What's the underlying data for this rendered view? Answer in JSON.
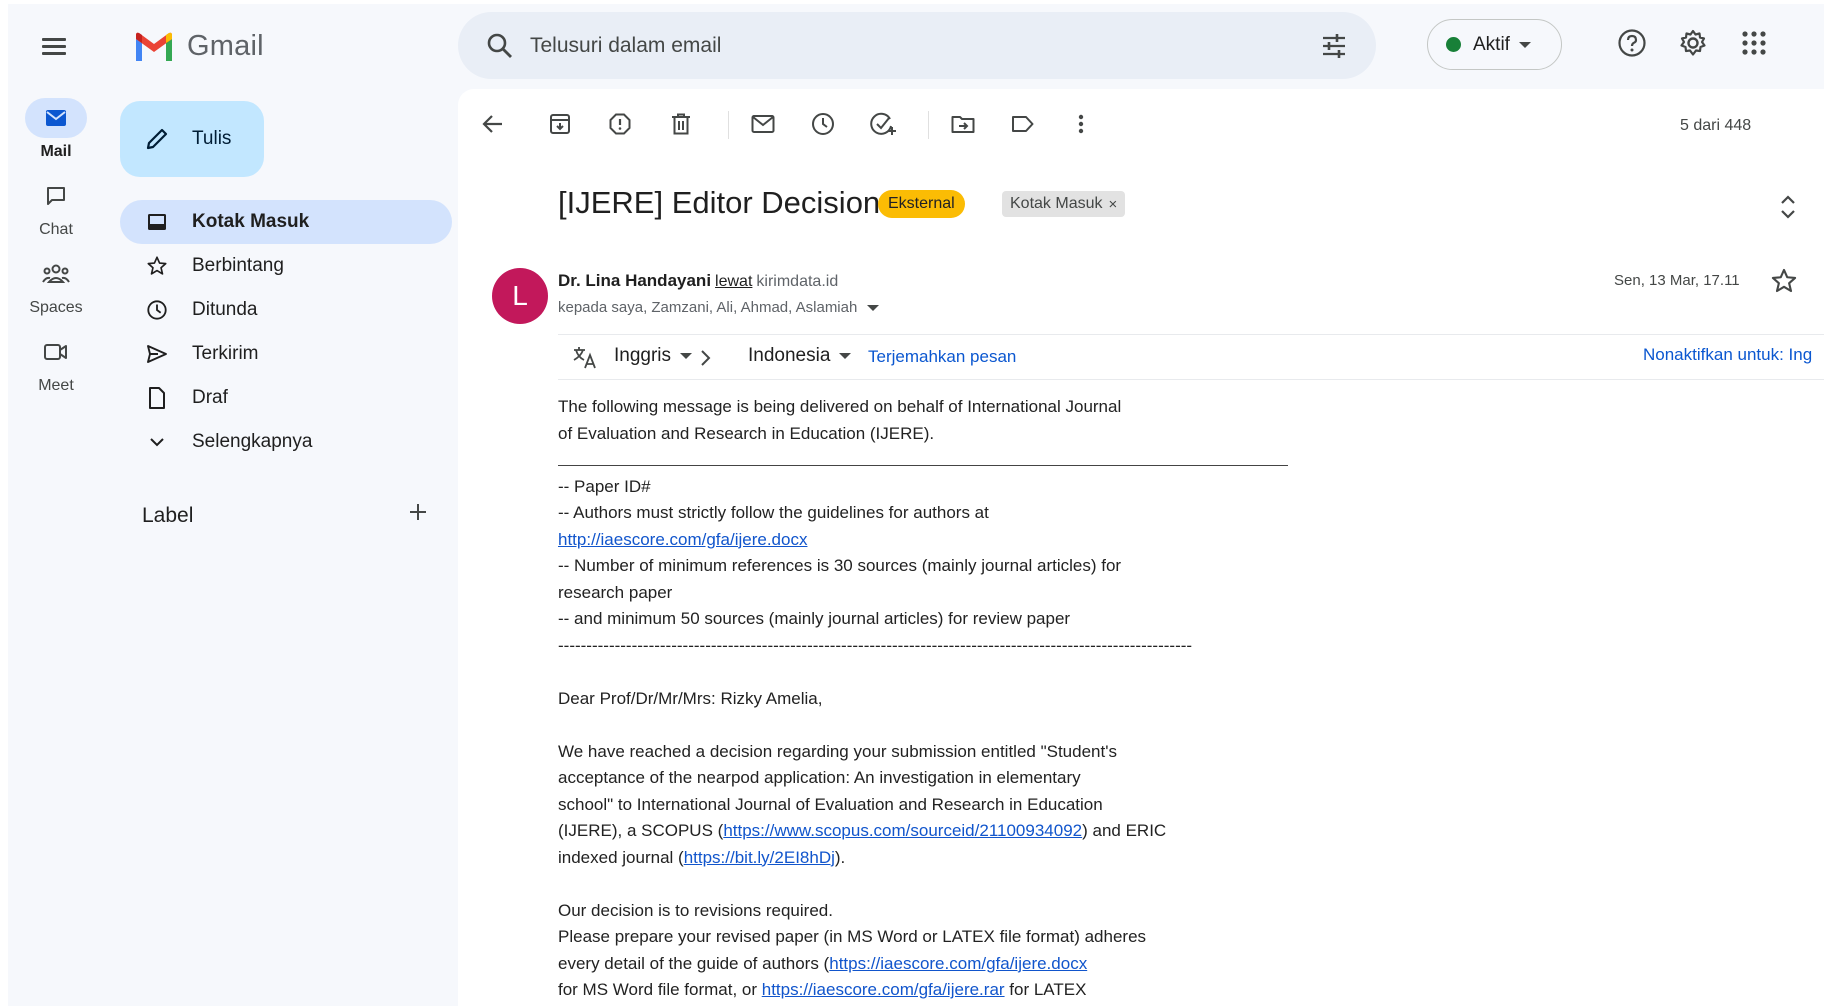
{
  "app": {
    "name": "Gmail"
  },
  "rail": [
    {
      "label": "Mail",
      "icon": "mail-icon",
      "active": true
    },
    {
      "label": "Chat",
      "icon": "chat-icon",
      "active": false
    },
    {
      "label": "Spaces",
      "icon": "spaces-icon",
      "active": false
    },
    {
      "label": "Meet",
      "icon": "meet-icon",
      "active": false
    }
  ],
  "compose": {
    "label": "Tulis"
  },
  "nav": [
    {
      "label": "Kotak Masuk",
      "icon": "inbox-icon",
      "active": true
    },
    {
      "label": "Berbintang",
      "icon": "star-icon"
    },
    {
      "label": "Ditunda",
      "icon": "clock-icon"
    },
    {
      "label": "Terkirim",
      "icon": "send-icon"
    },
    {
      "label": "Draf",
      "icon": "draft-icon"
    },
    {
      "label": "Selengkapnya",
      "icon": "chevron-down-icon"
    }
  ],
  "labels": {
    "heading": "Label"
  },
  "search": {
    "placeholder": "Telusuri dalam email"
  },
  "status": {
    "label": "Aktif",
    "color": "#188038"
  },
  "toolbar": {
    "count": "5 dari 448"
  },
  "email": {
    "subject": "[IJERE] Editor Decision",
    "badge_external": "Eksternal",
    "badge_inbox": "Kotak Masuk",
    "avatar_letter": "L",
    "sender_name": "Dr. Lina Handayani",
    "via": "lewat",
    "via_domain": "kirimdata.id",
    "recipients": "kepada saya, Zamzani, Ali, Ahmad, Aslamiah",
    "date": "Sen, 13 Mar, 17.11"
  },
  "translate": {
    "from": "Inggris",
    "to": "Indonesia",
    "translate_link": "Terjemahkan pesan",
    "disable_link": "Nonaktifkan untuk: Ing"
  },
  "body": {
    "intro_1": "The following message is being delivered on behalf of International Journal",
    "intro_2": "of Evaluation and Research in Education (IJERE).",
    "l_paper_id": "-- Paper ID#",
    "l_guidelines": "-- Authors must strictly follow the guidelines for authors at",
    "link_guide": "http://iaescore.com/gfa/ijere.docx",
    "l_refs_1": "-- Number of minimum references is 30 sources (mainly journal articles) for",
    "l_refs_2": "research paper",
    "l_refs_3": "-- and minimum 50 sources (mainly journal articles) for review paper",
    "dashes": "----------------------------------------------------------------------------------------------------------------",
    "salutation": "Dear Prof/Dr/Mr/Mrs: Rizky Amelia,",
    "d1": "We have reached a decision regarding your submission entitled \"Student's",
    "d2": "acceptance of the nearpod application: An investigation in elementary",
    "d3": "school\" to International Journal of Evaluation and Research in Education",
    "d4_a": "(IJERE), a SCOPUS (",
    "link_scopus": "https://www.scopus.com/sourceid/21100934092",
    "d4_b": ") and ERIC",
    "d5_a": "indexed journal (",
    "link_bitly": "https://bit.ly/2EI8hDj",
    "d5_b": ").",
    "decision": "Our decision is to revisions required.",
    "r1": "Please prepare your revised paper (in MS Word or LATEX file format) adheres",
    "r2_a": "every detail of the guide of authors (",
    "link_docx": "https://iaescore.com/gfa/ijere.docx",
    "r3_a": "for MS Word file format, or ",
    "link_rar": "https://iaescore.com/gfa/ijere.rar",
    "r3_b": " for LATEX"
  }
}
